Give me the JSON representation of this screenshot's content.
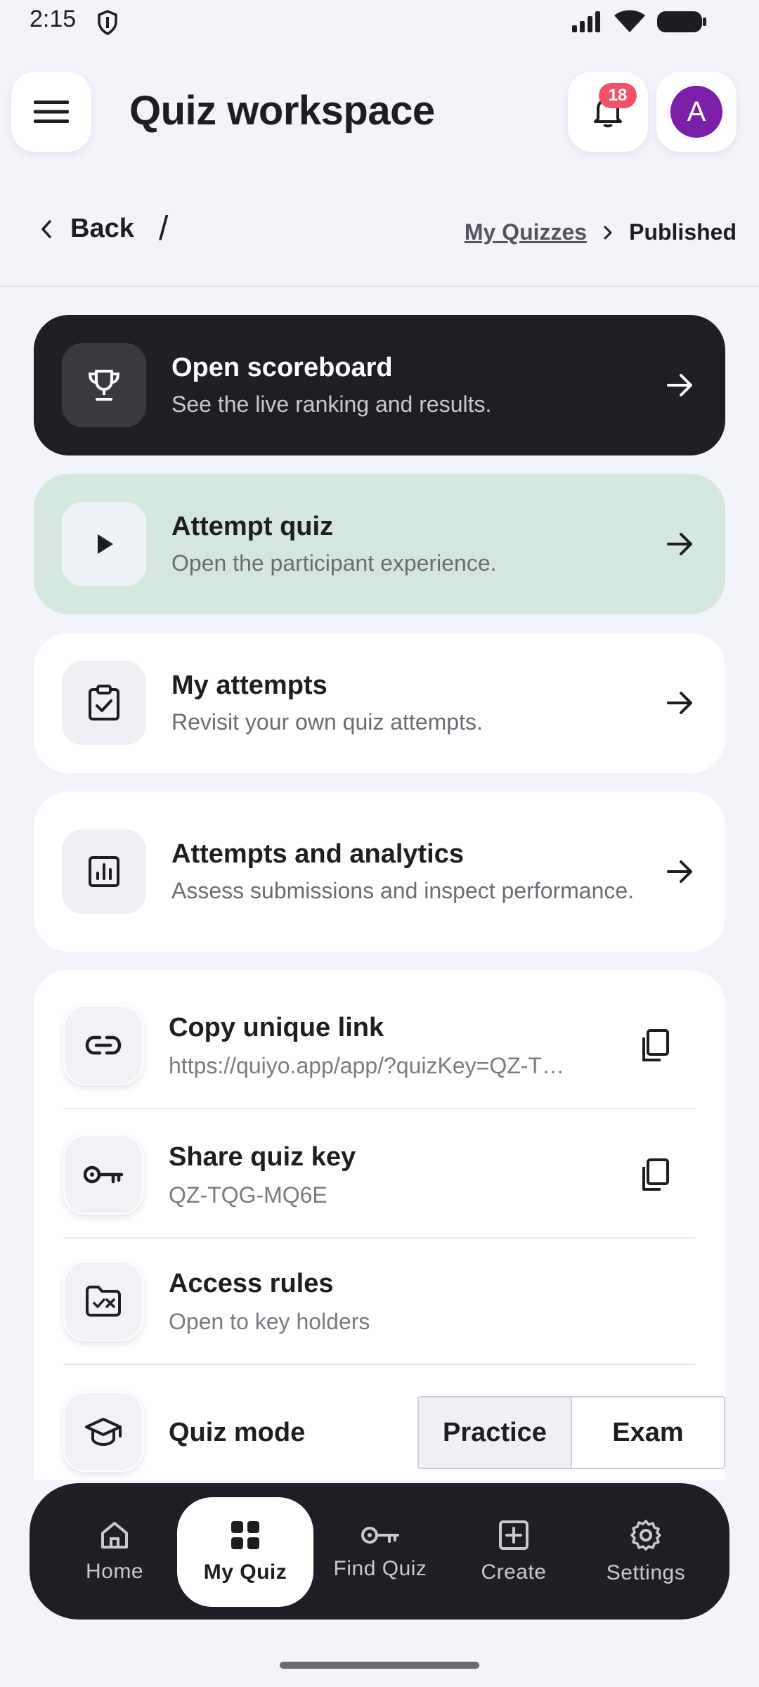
{
  "status_bar": {
    "time": "2:15"
  },
  "header": {
    "title": "Quiz workspace",
    "notification_count": "18",
    "avatar_initial": "A"
  },
  "breadcrumb": {
    "back_label": "Back",
    "separator": "/",
    "parent": "My Quizzes",
    "current": "Published"
  },
  "cards": [
    {
      "title": "Open scoreboard",
      "subtitle": "See the live ranking and results."
    },
    {
      "title": "Attempt quiz",
      "subtitle": "Open the participant experience."
    },
    {
      "title": "My attempts",
      "subtitle": "Revisit your own quiz attempts."
    },
    {
      "title": "Attempts and analytics",
      "subtitle": "Assess submissions and inspect performance."
    }
  ],
  "settings": {
    "copy_link": {
      "title": "Copy unique link",
      "value": "https://quiyo.app/app/?quizKey=QZ-T…"
    },
    "quiz_key": {
      "title": "Share quiz key",
      "value": "QZ-TQG-MQ6E"
    },
    "access": {
      "title": "Access rules",
      "value": "Open to key holders"
    },
    "mode": {
      "title": "Quiz mode",
      "options": [
        "Practice",
        "Exam"
      ],
      "selected": "Practice"
    }
  },
  "nav": {
    "items": [
      {
        "label": "Home",
        "icon": "home-icon"
      },
      {
        "label": "My Quiz",
        "icon": "grid-icon",
        "active": true
      },
      {
        "label": "Find Quiz",
        "icon": "key-icon"
      },
      {
        "label": "Create",
        "icon": "plus-square-icon"
      },
      {
        "label": "Settings",
        "icon": "gear-icon"
      }
    ]
  },
  "colors": {
    "background": "#f3f4fa",
    "dark": "#1e1f24",
    "mint": "#d4e7df",
    "badge": "#f0526a",
    "avatar": "#7a1fa8"
  }
}
